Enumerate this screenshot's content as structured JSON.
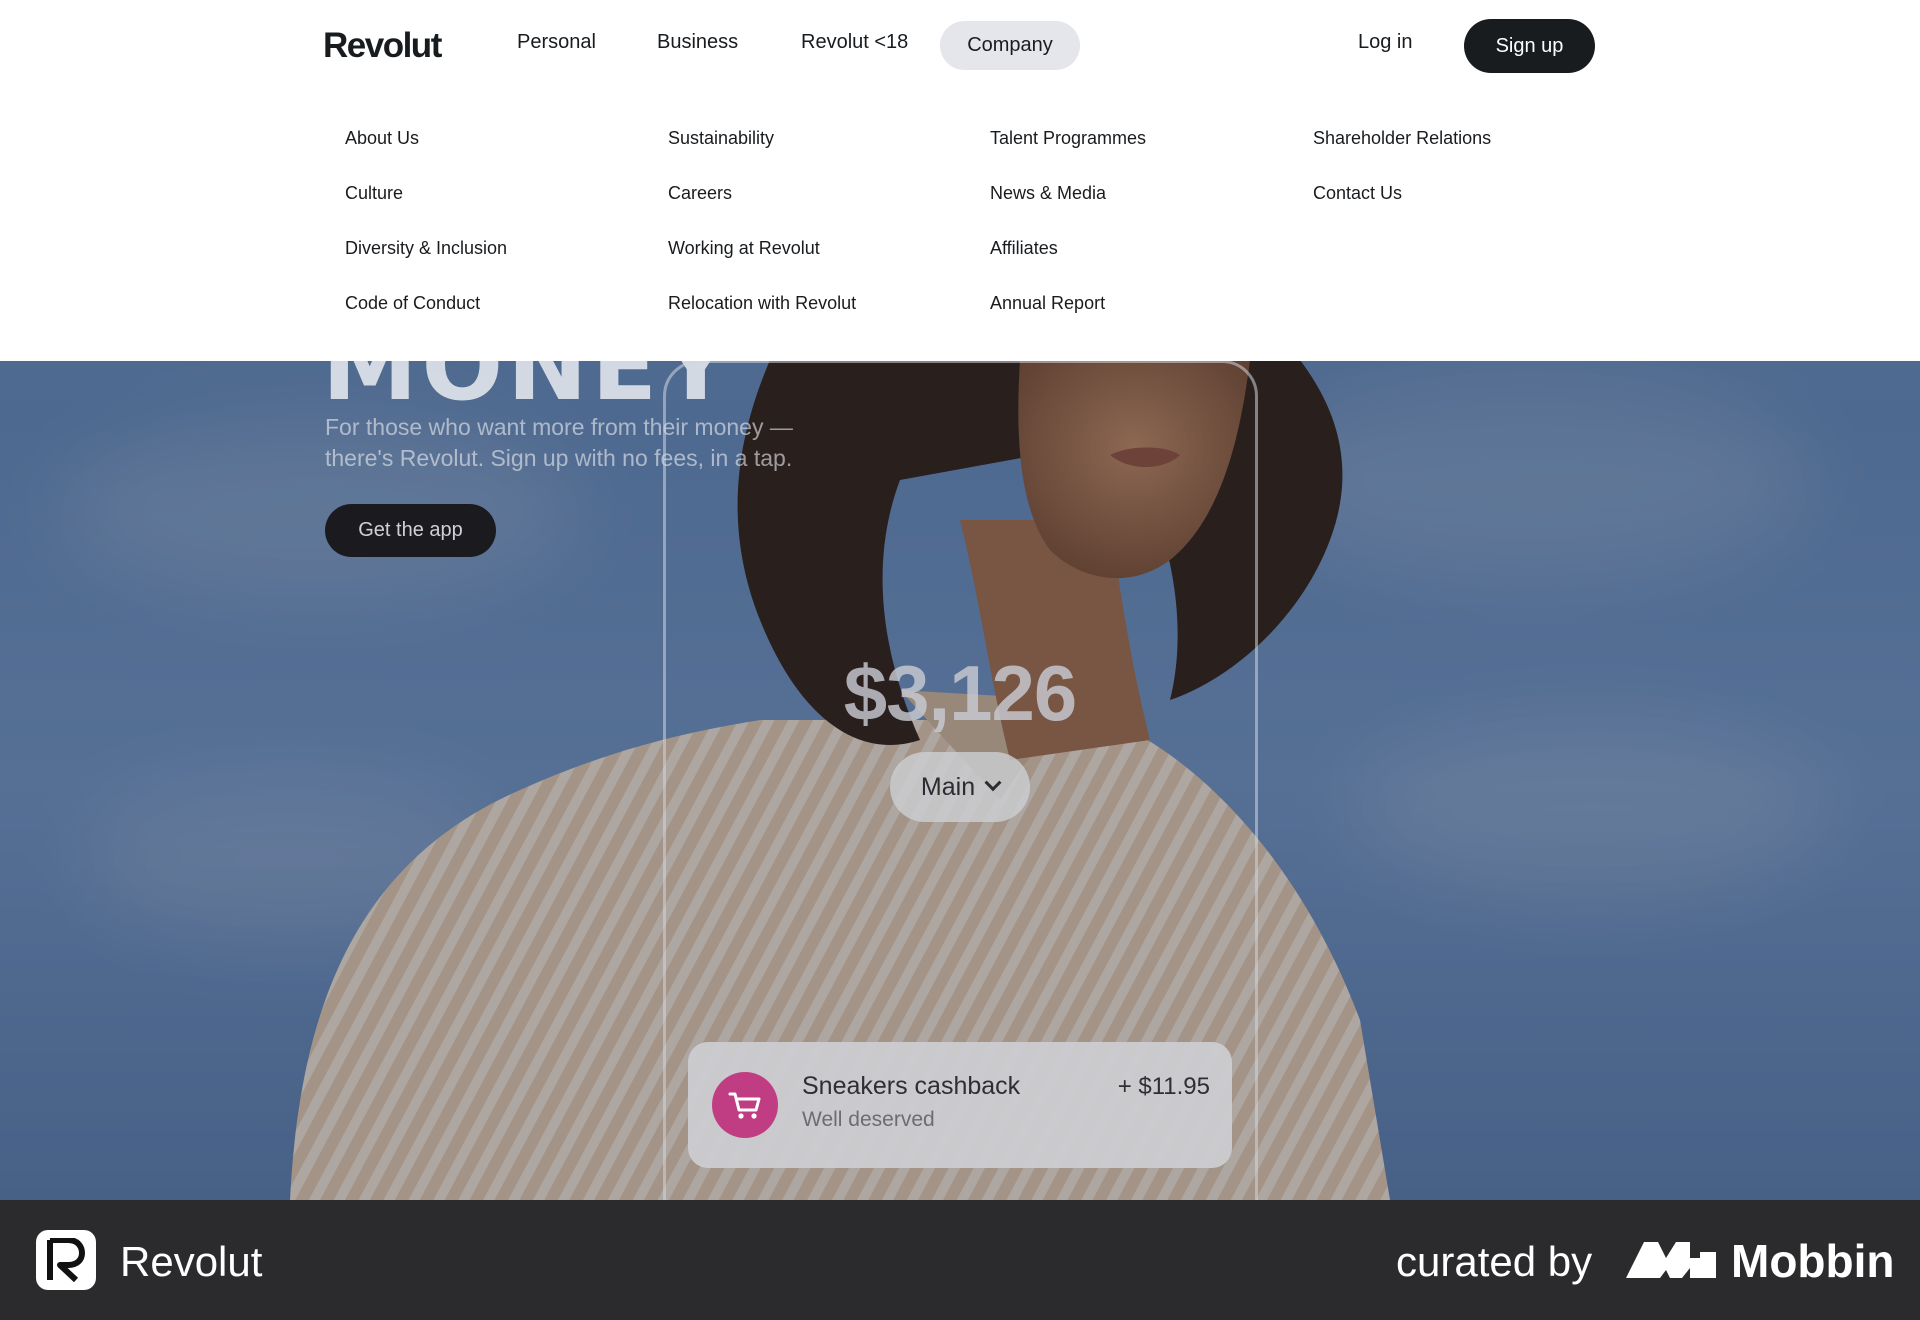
{
  "nav": {
    "logo": "Revolut",
    "items": [
      "Personal",
      "Business",
      "Revolut <18",
      "Company"
    ],
    "active_item": "Company",
    "login_label": "Log in",
    "signup_label": "Sign up"
  },
  "company_menu": {
    "columns": [
      [
        "About Us",
        "Culture",
        "Diversity & Inclusion",
        "Code of Conduct"
      ],
      [
        "Sustainability",
        "Careers",
        "Working at Revolut",
        "Relocation with Revolut"
      ],
      [
        "Talent Programmes",
        "News & Media",
        "Affiliates",
        "Annual Report"
      ],
      [
        "Shareholder Relations",
        "Contact Us"
      ]
    ]
  },
  "hero": {
    "heading_partial": "MONEY",
    "subtitle": "For those who want more from their money — there's Revolut. Sign up with no fees, in a tap.",
    "cta_label": "Get the app",
    "balance": "$3,126",
    "account_label": "Main",
    "cashback": {
      "title": "Sneakers cashback",
      "subtitle": "Well deserved",
      "amount": "+ $11.95",
      "icon": "shopping-cart-icon",
      "icon_color": "#c13d83"
    }
  },
  "footer": {
    "app_name": "Revolut",
    "curated_label": "curated by",
    "brand": "Mobbin"
  },
  "colors": {
    "primary_dark": "#191c1f",
    "nav_active_bg": "#e5e6eb",
    "footer_bg": "#2b2b2d"
  }
}
